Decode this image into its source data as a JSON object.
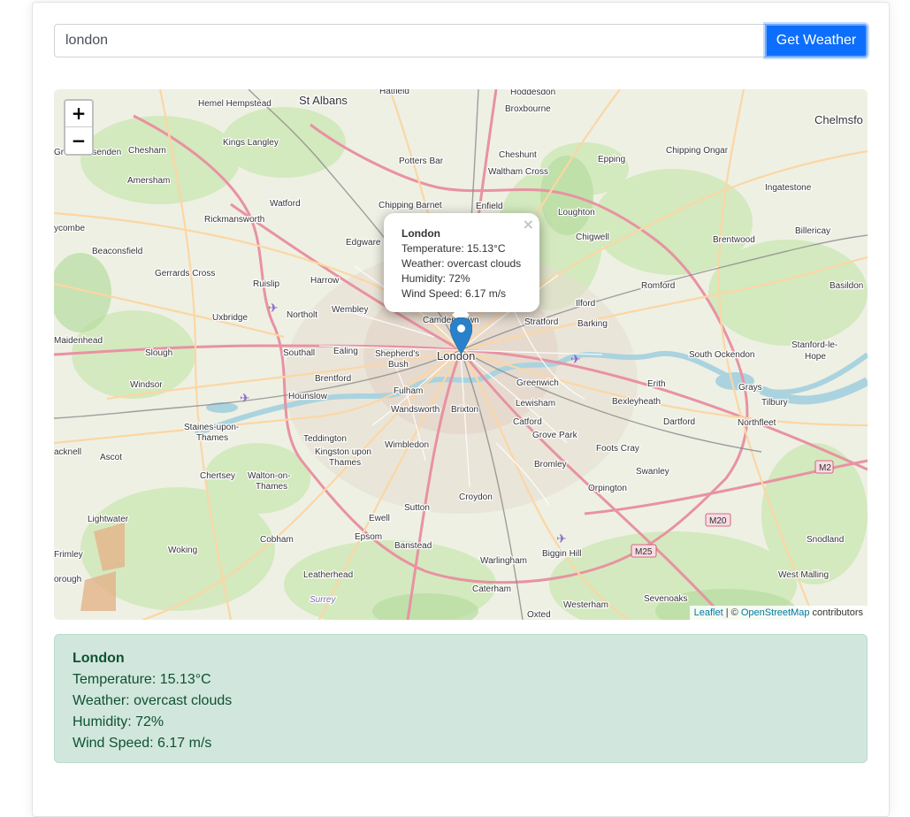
{
  "search": {
    "value": "london",
    "button_label": "Get Weather"
  },
  "map": {
    "zoom_in": "+",
    "zoom_out": "−",
    "popup": {
      "city": "London",
      "temperature": "Temperature: 15.13°C",
      "weather": "Weather: overcast clouds",
      "humidity": "Humidity: 72%",
      "wind": "Wind Speed: 6.17 m/s",
      "close": "×"
    },
    "attribution": {
      "leaflet": "Leaflet",
      "separator": " | © ",
      "osm": "OpenStreetMap",
      "suffix": " contributors"
    },
    "places": {
      "hatfield": "Hatfield",
      "hoddesdon": "Hoddesdon",
      "hemel": "Hemel Hempstead",
      "stalbans": "St Albans",
      "broxbourne": "Broxbourne",
      "chelmsford": "Chelmsfo",
      "kingslangley": "Kings Langley",
      "chesham": "Chesham",
      "gtmissenden": "Great Missenden",
      "pottersbar": "Potters Bar",
      "cheshunt": "Cheshunt",
      "walthamcross": "Waltham Cross",
      "epping": "Epping",
      "chippingongar": "Chipping Ongar",
      "amersham": "Amersham",
      "ingatestone": "Ingatestone",
      "watford": "Watford",
      "chippingbarnet": "Chipping Barnet",
      "enfield": "Enfield",
      "loughton": "Loughton",
      "rickmansworth": "Rickmansworth",
      "highwycombe": "ycombe",
      "chigwell": "Chigwell",
      "brentwood": "Brentwood",
      "billericay": "Billericay",
      "beaconsfield": "Beaconsfield",
      "edgware": "Edgware",
      "gerrardscross": "Gerrards Cross",
      "ruislip": "Ruislip",
      "harrow": "Harrow",
      "romford": "Romford",
      "basildon": "Basildon",
      "uxbridge": "Uxbridge",
      "northolt": "Northolt",
      "wembley": "Wembley",
      "camdentown": "Camden Town",
      "stratford": "Stratford",
      "ilford": "Ilford",
      "barking": "Barking",
      "maidenhead": "Maidenhead",
      "slough": "Slough",
      "southall": "Southall",
      "ealing": "Ealing",
      "shepherds": "Shepherd's",
      "bush": "Bush",
      "london": "London",
      "southockendon": "South Ockendon",
      "stanford": "Stanford-le-",
      "hope": "Hope",
      "windsor": "Windsor",
      "brentford": "Brentford",
      "hounslow": "Hounslow",
      "fulham": "Fulham",
      "greenwich": "Greenwich",
      "erith": "Erith",
      "grays": "Grays",
      "lewisham": "Lewisham",
      "bexleyheath": "Bexleyheath",
      "tilbury": "Tilbury",
      "wandsworth": "Wandsworth",
      "brixton": "Brixton",
      "catford": "Catford",
      "dartford": "Dartford",
      "northfleet": "Northfleet",
      "staines": "Staines-upon-",
      "thames1": "Thames",
      "groveperk": "Grove Park",
      "teddington": "Teddington",
      "wimbledon": "Wimbledon",
      "ascot": "Ascot",
      "bracknell": "acknell",
      "kingston": "Kingston upon",
      "thames2": "Thames",
      "footscray": "Foots Cray",
      "bromley": "Bromley",
      "swanley": "Swanley",
      "chertsey": "Chertsey",
      "walton": "Walton-on-",
      "thames3": "Thames",
      "orpington": "Orpington",
      "croydon": "Croydon",
      "sutton": "Sutton",
      "lightwater": "Lightwater",
      "ewell": "Ewell",
      "cobham": "Cobham",
      "epsom": "Epsom",
      "banstead": "Banstead",
      "snodland": "Snodland",
      "woking": "Woking",
      "frimley": "Frimley",
      "bigginhill": "Biggin Hill",
      "warlingham": "Warlingham",
      "leatherhead": "Leatherhead",
      "westmalling": "West Malling",
      "farnborough": "orough",
      "surrey": "Surrey",
      "caterham": "Caterham",
      "sevenoaks": "Sevenoaks",
      "westerham": "Westerham",
      "oxted": "Oxted",
      "m2": "M2",
      "m20": "M20",
      "m25": "M25"
    }
  },
  "result": {
    "city": "London",
    "temperature": "Temperature: 15.13°C",
    "weather": "Weather: overcast clouds",
    "humidity": "Humidity: 72%",
    "wind": "Wind Speed: 6.17 m/s"
  },
  "colors": {
    "button": "#0d6efd",
    "result_bg": "#d1e7dd",
    "result_text": "#0f5132",
    "marker": "#2a81cb"
  }
}
